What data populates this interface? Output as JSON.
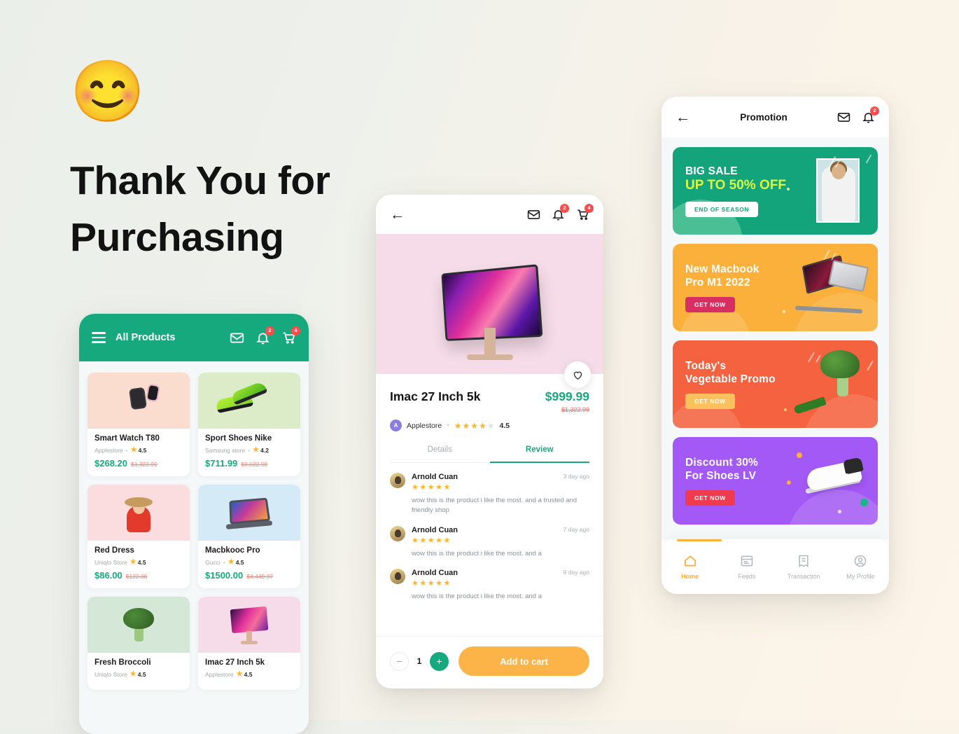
{
  "hero": {
    "emoji": "😊",
    "emoji_name": "smiling-face-emoji",
    "title_line1": "Thank You for",
    "title_line2": "Purchasing"
  },
  "colors": {
    "primary_green": "#17A97E",
    "accent_orange": "#FCB448",
    "badge_red": "#FF4B4B",
    "old_price_red": "#FF6A5B",
    "star_gold": "#FFB422"
  },
  "products_screen": {
    "header": {
      "menu_icon": "hamburger-menu-icon",
      "title": "All Products",
      "mail_icon": "mail-icon",
      "bell_icon": "bell-icon",
      "bell_badge": "2",
      "cart_icon": "cart-icon",
      "cart_badge": "4"
    },
    "items": [
      {
        "name": "Smart Watch T80",
        "store": "Applestore",
        "rating": "4.5",
        "price": "$268.20",
        "old_price": "$1,322.99"
      },
      {
        "name": "Sport Shoes Nike",
        "store": "Samsung store",
        "rating": "4.2",
        "price": "$711.99",
        "old_price": "$9,022.99"
      },
      {
        "name": "Red Dress",
        "store": "Uniqlo Store",
        "rating": "4.5",
        "price": "$86.00",
        "old_price": "$122.00"
      },
      {
        "name": "Macbkooc Pro",
        "store": "Gucci",
        "rating": "4.5",
        "price": "$1500.00",
        "old_price": "$4,449.97"
      },
      {
        "name": "Fresh Broccoli",
        "store": "Uniqlo Store",
        "rating": "4.5",
        "price": "",
        "old_price": ""
      },
      {
        "name": "Imac 27 Inch 5k",
        "store": "Applestore",
        "rating": "4.5",
        "price": "",
        "old_price": ""
      }
    ]
  },
  "detail_screen": {
    "header": {
      "back_icon": "arrow-left-icon",
      "mail_icon": "mail-icon",
      "bell_icon": "bell-icon",
      "bell_badge": "2",
      "cart_icon": "cart-icon",
      "cart_badge": "4"
    },
    "favorite_icon": "heart-icon",
    "product": {
      "name": "Imac 27 Inch 5k",
      "price": "$999.99",
      "old_price": "$1,322.99",
      "store": "Applestore",
      "store_initial": "A",
      "rating": "4.5",
      "stars_filled": 4,
      "stars_total": 5
    },
    "tabs": [
      {
        "label": "Details",
        "active": false
      },
      {
        "label": "Review",
        "active": true
      }
    ],
    "reviews": [
      {
        "author": "Arnold Cuan",
        "stars": "★★★★★",
        "time": "3 day ago",
        "text": "wow this is the product i like the most. and a trusted and friendly shop"
      },
      {
        "author": "Arnold Cuan",
        "stars": "★★★★★",
        "time": "7 day ago",
        "text": "wow this is the product i like the most. and a"
      },
      {
        "author": "Arnold Cuan",
        "stars": "★★★★★",
        "time": "9 day ago",
        "text": "wow this is the product i like the most. and a"
      }
    ],
    "footer": {
      "minus_label": "−",
      "quantity": "1",
      "plus_label": "+",
      "add_to_cart_label": "Add to cart"
    }
  },
  "promotion_screen": {
    "header": {
      "back_icon": "arrow-left-icon",
      "title": "Promotion",
      "mail_icon": "mail-icon",
      "bell_icon": "bell-icon",
      "bell_badge": "2"
    },
    "banners": [
      {
        "line1": "BIG SALE",
        "line2": "UP TO 50% OFF",
        "button": "END OF SEASON",
        "color": "#13A47C"
      },
      {
        "line1": "New Macbook",
        "line2": "Pro M1 2022",
        "button": "GET NOW",
        "color": "#FBB03B"
      },
      {
        "line1": "Today's",
        "line2": "Vegetable Promo",
        "button": "GET NOW",
        "color": "#F4623F"
      },
      {
        "line1": "Discount 30%",
        "line2": "For Shoes LV",
        "button": "GET NOW",
        "color": "#A259F5"
      }
    ],
    "nav": [
      {
        "label": "Home",
        "icon": "home-icon",
        "active": true
      },
      {
        "label": "Feeds",
        "icon": "feeds-icon",
        "active": false
      },
      {
        "label": "Transaction",
        "icon": "receipt-icon",
        "active": false
      },
      {
        "label": "My Profile",
        "icon": "user-circle-icon",
        "active": false
      }
    ]
  }
}
